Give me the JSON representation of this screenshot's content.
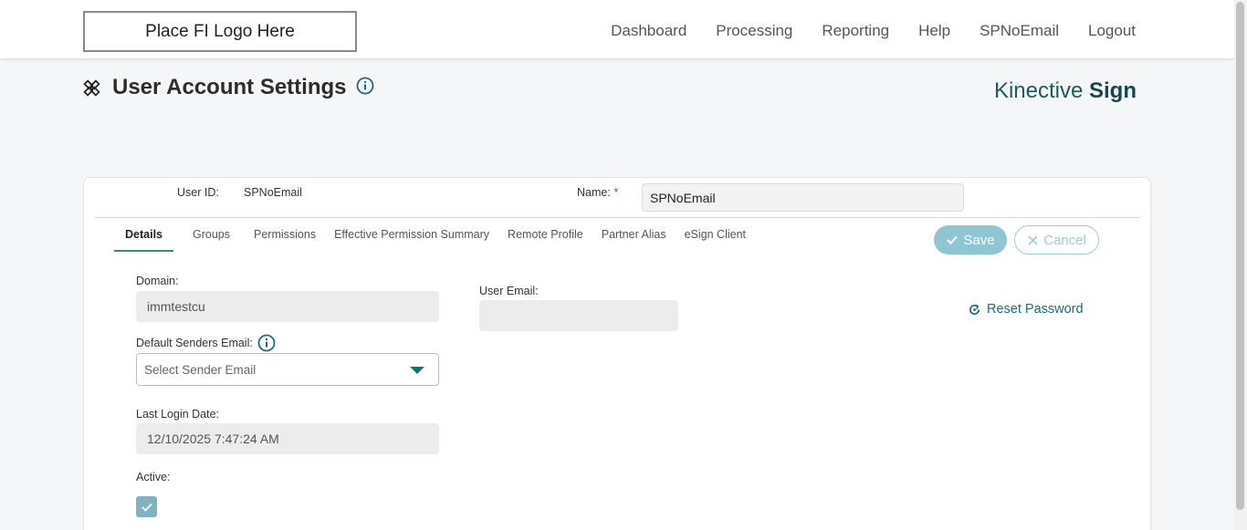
{
  "header": {
    "logo_text": "Place FI Logo Here",
    "nav": [
      "Dashboard",
      "Processing",
      "Reporting",
      "Help",
      "SPNoEmail",
      "Logout"
    ]
  },
  "page": {
    "title": "User Account Settings",
    "brand_light": "Kinective ",
    "brand_bold": "Sign"
  },
  "user": {
    "user_id_label": "User ID:",
    "user_id_value": "SPNoEmail",
    "name_label": "Name:",
    "name_required": "*",
    "name_value": "SPNoEmail"
  },
  "tabs": [
    "Details",
    "Groups",
    "Permissions",
    "Effective Permission Summary",
    "Remote Profile",
    "Partner Alias",
    "eSign Client"
  ],
  "actions": {
    "save": "Save",
    "cancel": "Cancel",
    "reset_password": "Reset Password"
  },
  "details": {
    "domain_label": "Domain:",
    "domain_value": "immtestcu",
    "user_email_label": "User Email:",
    "user_email_value": "",
    "default_senders_label": "Default Senders Email:",
    "sender_placeholder": "Select Sender Email",
    "last_login_label": "Last Login Date:",
    "last_login_value": "12/10/2025 7:47:24 AM",
    "active_label": "Active:",
    "active_checked": true
  },
  "colors": {
    "accent": "#1f6b7a",
    "tab_underline": "#3a8f6e",
    "save_bg": "#8fc6d2",
    "brand": "#17474a"
  }
}
